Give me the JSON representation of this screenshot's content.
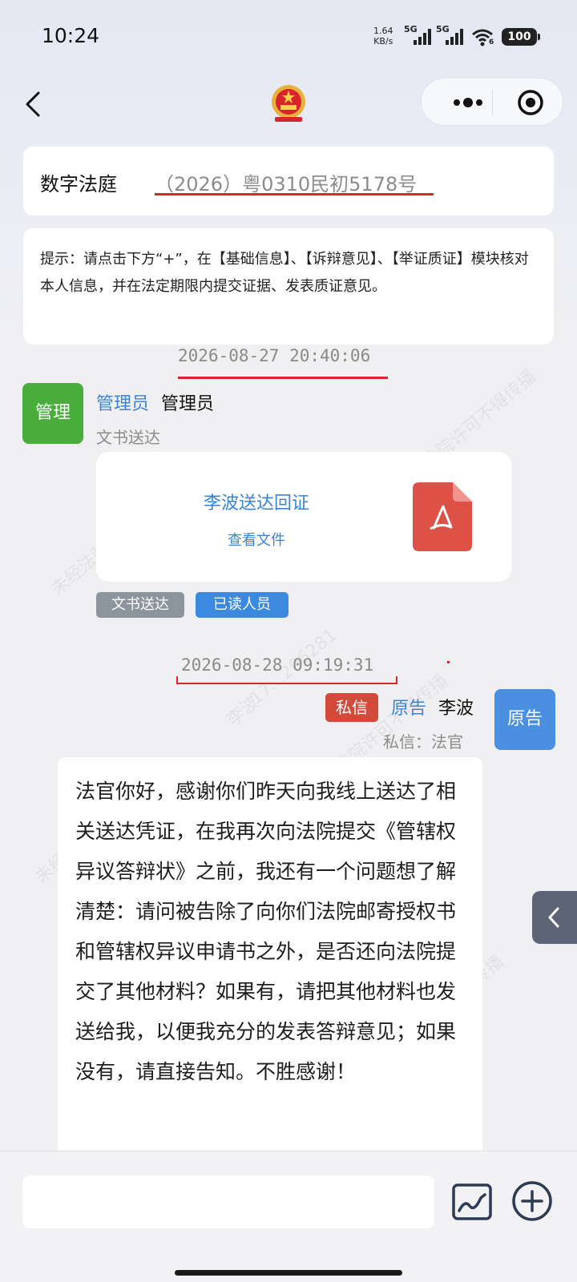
{
  "status_bar": {
    "time": "10:24",
    "net_speed_value": "1.64",
    "net_speed_unit": "KB/s",
    "sim1_label": "5G",
    "sim2_label": "5G",
    "wifi_label": "6",
    "battery": "100"
  },
  "header": {
    "title": "数字法庭",
    "case_number": "（2026）粤0310民初5178号"
  },
  "tip": {
    "text": "提示：请点击下方“+”，在【基础信息】、【诉辩意见】、【举证质证】模块核对本人信息，并在法定期限内提交证据、发表质证意见。"
  },
  "watermark": {
    "court_text": "未经法院许可不得传播",
    "phone_partial": "17...206281",
    "name": "李波"
  },
  "messages": [
    {
      "timestamp": "2026-08-27 20:40:06",
      "avatar": "管理",
      "role": "管理员",
      "name": "管理员",
      "subtitle": "文书送达",
      "file_title": "李波送达回证",
      "file_link": "查看文件",
      "tags": [
        "文书送达",
        "已读人员"
      ]
    },
    {
      "timestamp": "2026-08-28 09:19:31",
      "avatar": "原告",
      "private_tag": "私信",
      "role": "原告",
      "name": "李波",
      "subtitle": "私信：法官",
      "text": "法官你好，感谢你们昨天向我线上送达了相关送达凭证，在我再次向法院提交《管辖权异议答辩状》之前，我还有一个问题想了解清楚：请问被告除了向你们法院邮寄授权书和管辖权异议申请书之外，是否还向法院提交了其他材料？如果有，请把其他材料也发送给我，以便我充分的发表答辩意见；如果没有，请直接告知。不胜感谢！"
    }
  ],
  "input": {
    "placeholder": ""
  },
  "colors": {
    "accent_blue": "#3a84d8",
    "admin_green": "#49ad3c",
    "highlight_red": "#d9262b",
    "private_red": "#d24a3a"
  },
  "icons": [
    "back-arrow-icon",
    "national-emblem-icon",
    "more-dots-icon",
    "close-mini-program-icon",
    "pdf-file-icon",
    "image-upload-icon",
    "add-circle-icon",
    "chevron-left-icon"
  ]
}
